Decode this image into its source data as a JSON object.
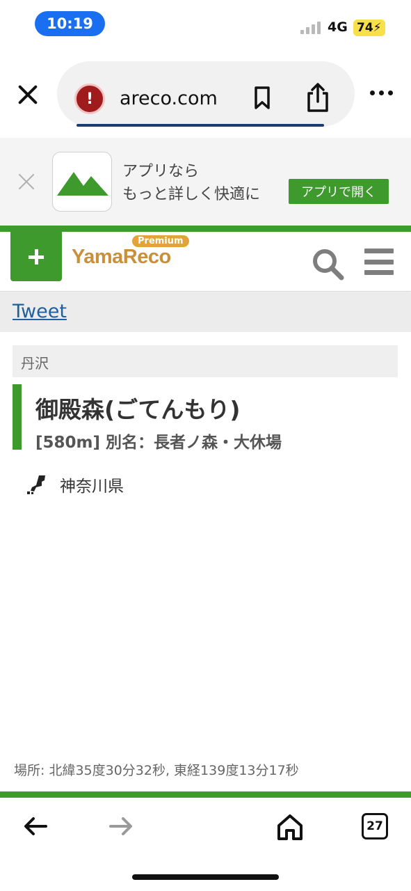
{
  "status_bar": {
    "time": "10:19",
    "network": "4G",
    "battery": "74"
  },
  "browser": {
    "url": "areco.com",
    "tabs_count": "27"
  },
  "app_banner": {
    "line1": "アプリなら",
    "line2": "もっと詳しく快適に",
    "open_button": "アプリで開く"
  },
  "site_header": {
    "logo": "YamaReco",
    "badge": "Premium"
  },
  "tweet_label": "Tweet",
  "mountain": {
    "area": "丹沢",
    "name": "御殿森(ごてんもり)",
    "subtitle": "[580m] 別名：長者ノ森・大休場",
    "prefecture": "神奈川県",
    "location": "場所: 北緯35度30分32秒, 東経139度13分17秒"
  },
  "colors": {
    "accent_green": "#3f9a2e",
    "status_blue": "#1a6ff0",
    "logo_gold": "#c98f3a"
  }
}
